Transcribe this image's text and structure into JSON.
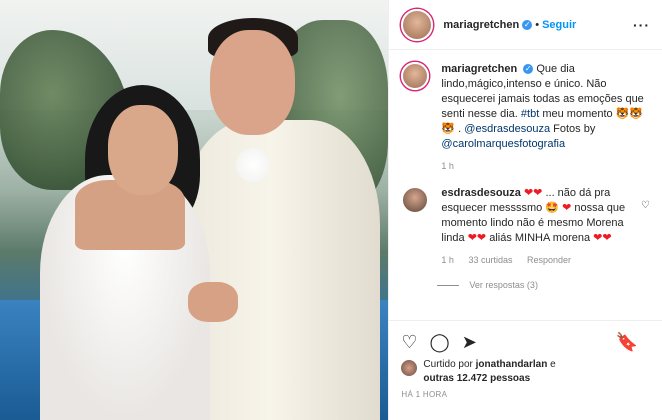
{
  "post": {
    "username": "mariagretchen",
    "follow_label": "Seguir",
    "more_icon": "more-icon"
  },
  "caption": {
    "username": "mariagretchen",
    "text": "Que dia lindo,mágico,intenso e único. Não esquecerei jamais todas as emoções que senti nesse dia.",
    "hashtag": "#tbt",
    "text2": "meu momento",
    "emojis": "🐯🐯🐯",
    "mention": "@esdrasdesouza",
    "fotos_prefix": "Fotos by",
    "photo_credit": "@carolmarquesfotografia",
    "age": "1 h"
  },
  "comment": {
    "username": "esdrasdesouza",
    "text_a": "... não dá pra esquecer messssmo",
    "text_b": "nossa que momento lindo não é mesmo Morena linda",
    "text_c": "aliás MINHA morena",
    "hearts": "❤❤",
    "age": "1 h",
    "likes": "33 curtidas",
    "reply_label": "Responder",
    "view_replies": "Ver respostas (3)"
  },
  "likes_line": {
    "prefix": "Curtido por",
    "user": "jonathandarlan",
    "mid": "e",
    "count": "outras 12.472 pessoas"
  },
  "timestamp": "HÁ 1 HORA",
  "colors": {
    "link_blue": "#0095f6",
    "verified": "#3897f0",
    "heart": "#ed1c24"
  }
}
